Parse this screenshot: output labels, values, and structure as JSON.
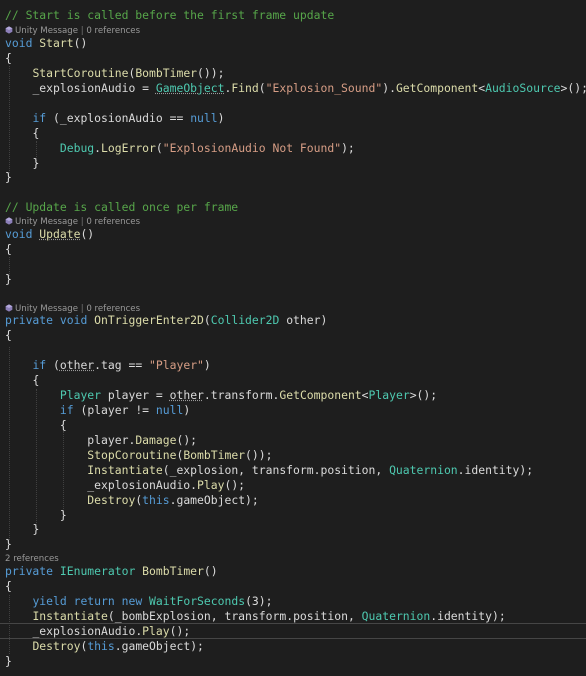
{
  "colors": {
    "background": "#1e1e1e",
    "comment": "#57a64a",
    "keyword": "#569cd6",
    "type": "#4ec9b0",
    "method": "#dcdcaa",
    "string": "#d69d85",
    "plain": "#dcdcdc",
    "codelens": "#999999"
  },
  "icons": {
    "unity_message": "unity-cube-icon"
  },
  "codelens": {
    "unity_message": "Unity Message",
    "separator": " | ",
    "zero_refs": "0 references",
    "two_refs": "2 references"
  },
  "code": {
    "comment_start": "// Start is called before the first frame update",
    "comment_update": "// Update is called once per frame",
    "kw_void": "void",
    "kw_if": "if",
    "kw_null": "null",
    "kw_private": "private",
    "kw_yield": "yield",
    "kw_return": "return",
    "kw_new": "new",
    "kw_this": "this",
    "fn_start": "Start",
    "fn_update": "Update",
    "fn_ontrigger": "OnTriggerEnter2D",
    "fn_startcoroutine": "StartCoroutine",
    "fn_bombtimer": "BombTimer",
    "fn_find": "Find",
    "fn_getcomponent": "GetComponent",
    "fn_logerror": "LogError",
    "fn_damage": "Damage",
    "fn_stopcoroutine": "StopCoroutine",
    "fn_instantiate": "Instantiate",
    "fn_play": "Play",
    "fn_destroy": "Destroy",
    "ty_gameobject": "GameObject",
    "ty_audiosource": "AudioSource",
    "ty_debug": "Debug",
    "ty_collider2d": "Collider2D",
    "ty_player": "Player",
    "ty_quaternion": "Quaternion",
    "ty_ienumerator": "IEnumerator",
    "ty_waitforseconds": "WaitForSeconds",
    "var_explosionaudio": "_explosionAudio",
    "var_explosion": "_explosion",
    "var_bombexplosion": "_bombExplosion",
    "var_other": "other",
    "var_player": "player",
    "var_transform": "transform",
    "var_position": "position",
    "var_identity": "identity",
    "var_tag": "tag",
    "var_gameobject": "gameObject",
    "str_explosion_sound": "\"Explosion_Sound\"",
    "str_explosion_not_found": "\"ExplosionAudio Not Found\"",
    "str_player": "\"Player\"",
    "num_3": "3"
  }
}
